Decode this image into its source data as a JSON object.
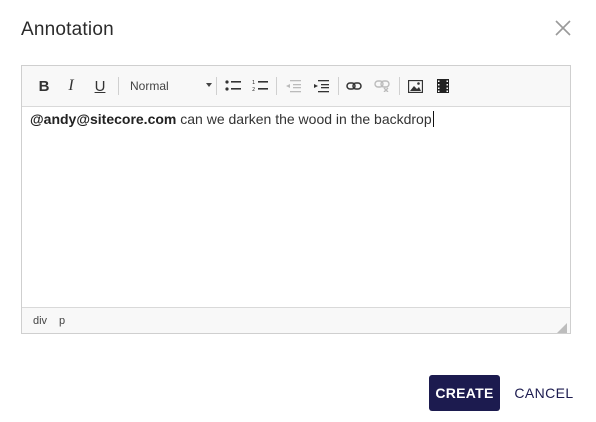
{
  "dialog": {
    "title": "Annotation",
    "close_icon": "close-icon"
  },
  "editor": {
    "toolbar": {
      "bold_label": "B",
      "italic_label": "I",
      "underline_label": "U",
      "format_value": "Normal",
      "icons": [
        "bold-icon",
        "italic-icon",
        "underline-icon",
        "format-select",
        "bulleted-list-icon",
        "numbered-list-icon",
        "decrease-indent-icon",
        "increase-indent-icon",
        "link-icon",
        "unlink-icon",
        "image-icon",
        "video-icon"
      ]
    },
    "content": {
      "mention": "@andy@sitecore.com",
      "text": " can we darken the wood in the backdrop"
    },
    "statusbar": {
      "path": [
        "div",
        "p"
      ]
    }
  },
  "footer": {
    "create_label": "CREATE",
    "cancel_label": "CANCEL"
  },
  "colors": {
    "primary": "#1c1b4f",
    "border": "#cfcfcf",
    "toolbar_bg": "#f8f8f8"
  }
}
